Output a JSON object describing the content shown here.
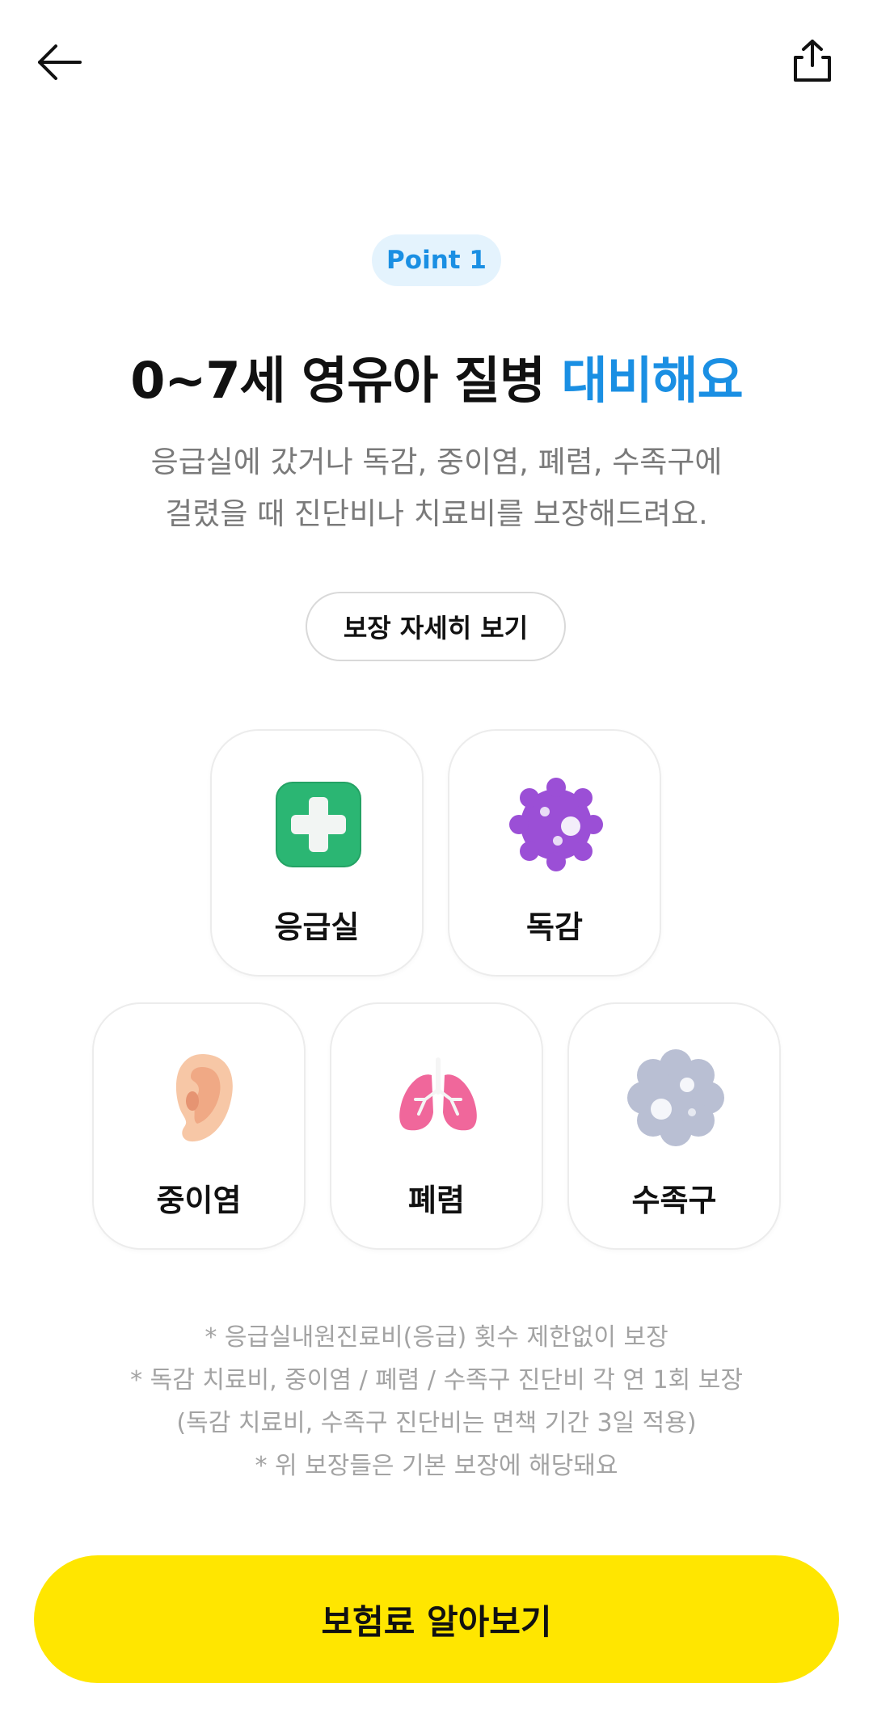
{
  "header": {
    "back_icon": "arrow-left-icon",
    "share_icon": "share-icon"
  },
  "badge": {
    "label": "Point 1"
  },
  "headline": {
    "main": "0~7세 영유아 질병 ",
    "highlight": "대비해요",
    "highlight_color": "#1a8fe3"
  },
  "description": {
    "line1": "응급실에 갔거나 독감, 중이염, 폐렴, 수족구에",
    "line2": "걸렸을 때 진단비나 치료비를 보장해드려요."
  },
  "detail_button": {
    "label": "보장 자세히 보기"
  },
  "coverage_items": [
    {
      "label": "응급실",
      "icon": "green-cross-icon"
    },
    {
      "label": "독감",
      "icon": "purple-virus-icon"
    },
    {
      "label": "중이염",
      "icon": "ear-icon"
    },
    {
      "label": "폐렴",
      "icon": "lungs-icon"
    },
    {
      "label": "수족구",
      "icon": "gray-virus-icon"
    }
  ],
  "notes": [
    "* 응급실내원진료비(응급) 횟수 제한없이 보장",
    "* 독감 치료비, 중이염 / 폐렴 / 수족구 진단비 각 연 1회 보장",
    "(독감 치료비, 수족구 진단비는 면책 기간 3일 적용)",
    "* 위 보장들은 기본 보장에 해당돼요"
  ],
  "cta": {
    "label": "보험료 알아보기",
    "color": "#ffe600"
  }
}
